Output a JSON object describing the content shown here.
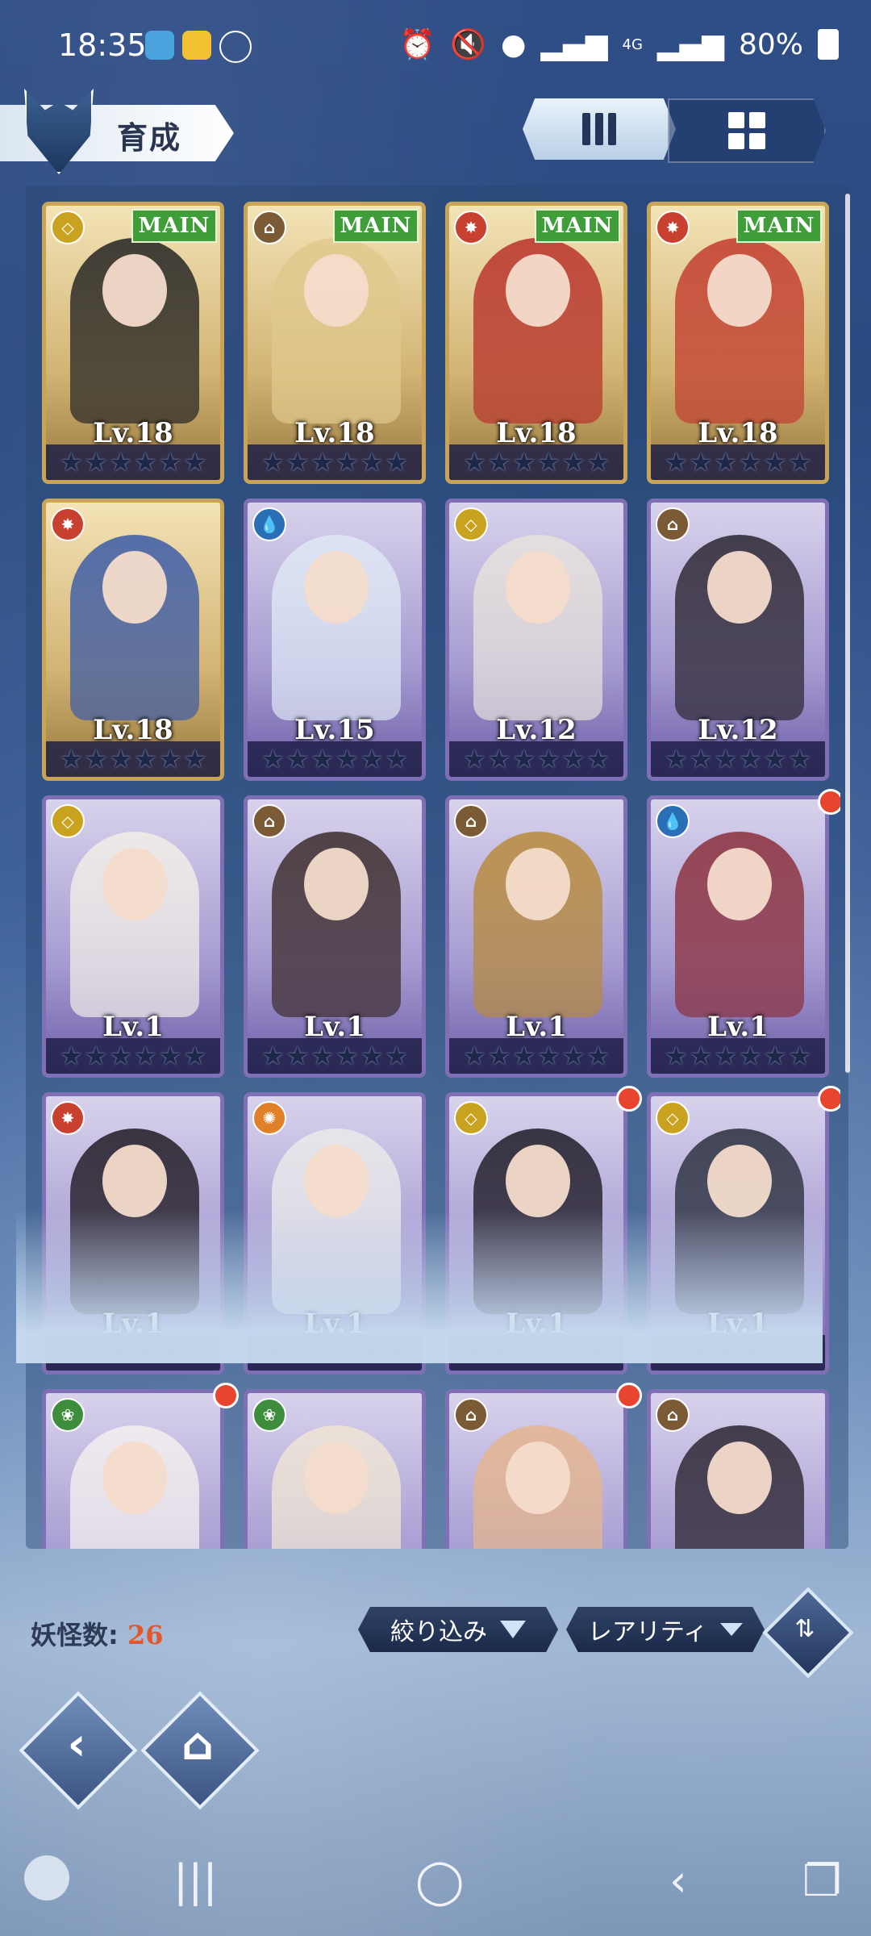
{
  "status_bar": {
    "time": "18:35",
    "battery": "80%",
    "network": "4G"
  },
  "header": {
    "title": "育成",
    "view_modes": [
      "list-view-icon",
      "grid-view-icon"
    ]
  },
  "cards": [
    {
      "level": "Lv.18",
      "main": "MAIN",
      "element": "light",
      "frame": "gold",
      "accent": "#222222"
    },
    {
      "level": "Lv.18",
      "main": "MAIN",
      "element": "earth",
      "frame": "gold",
      "accent": "#e0c98d"
    },
    {
      "level": "Lv.18",
      "main": "MAIN",
      "element": "fire",
      "frame": "gold",
      "accent": "#b8302a"
    },
    {
      "level": "Lv.18",
      "main": "MAIN",
      "element": "fire",
      "frame": "gold",
      "accent": "#c23b2d"
    },
    {
      "level": "Lv.18",
      "main": "",
      "element": "fire",
      "frame": "gold",
      "accent": "#3a5aa8"
    },
    {
      "level": "Lv.15",
      "main": "",
      "element": "water",
      "frame": "purple",
      "accent": "#dfe8f5"
    },
    {
      "level": "Lv.12",
      "main": "",
      "element": "light",
      "frame": "purple",
      "accent": "#e7e2dc"
    },
    {
      "level": "Lv.12",
      "main": "",
      "element": "earth",
      "frame": "purple",
      "accent": "#2a2530"
    },
    {
      "level": "Lv.1",
      "main": "",
      "element": "light",
      "frame": "purple",
      "accent": "#f2efe8"
    },
    {
      "level": "Lv.1",
      "main": "",
      "element": "earth",
      "frame": "purple",
      "accent": "#3a2a2a"
    },
    {
      "level": "Lv.1",
      "main": "",
      "element": "earth",
      "frame": "purple",
      "accent": "#b88a3a"
    },
    {
      "level": "Lv.1",
      "main": "",
      "element": "water",
      "frame": "purple",
      "accent": "#8b2e3a",
      "dot": true
    },
    {
      "level": "Lv.1",
      "main": "",
      "element": "fire",
      "frame": "purple",
      "accent": "#1f1a22"
    },
    {
      "level": "Lv.1",
      "main": "",
      "element": "sun",
      "frame": "purple",
      "accent": "#eaeaea"
    },
    {
      "level": "Lv.1",
      "main": "",
      "element": "light",
      "frame": "purple",
      "accent": "#1e1a25",
      "dot": true
    },
    {
      "level": "Lv.1",
      "main": "",
      "element": "light",
      "frame": "purple",
      "accent": "#2a2f3d",
      "dot": true
    },
    {
      "level": "",
      "main": "",
      "element": "wind",
      "frame": "purple",
      "accent": "#f4f0ef",
      "dot": true
    },
    {
      "level": "",
      "main": "",
      "element": "wind",
      "frame": "purple",
      "accent": "#efe5d5"
    },
    {
      "level": "",
      "main": "",
      "element": "earth",
      "frame": "purple",
      "accent": "#e5b58e",
      "dot": true
    },
    {
      "level": "",
      "main": "",
      "element": "earth",
      "frame": "purple",
      "accent": "#2a2430"
    }
  ],
  "footer": {
    "count_label": "妖怪数:",
    "count_value": "26",
    "filter_label": "絞り込み",
    "sort_label": "レアリティ"
  },
  "colors": {
    "gold_frame": "#c9a457",
    "purple_frame": "#7f6fb5",
    "main_badge": "#3f9e3a",
    "notify": "#e8452f"
  }
}
